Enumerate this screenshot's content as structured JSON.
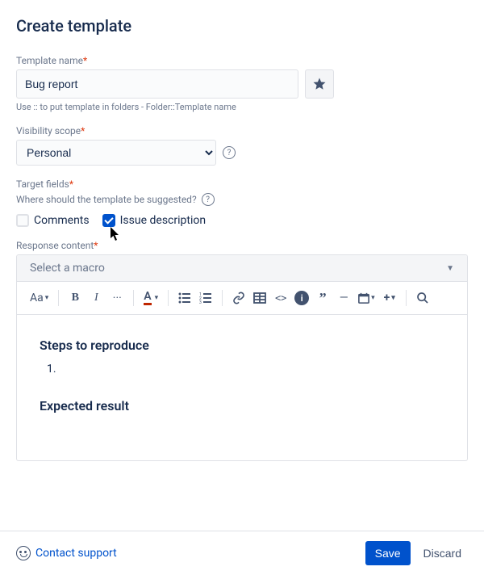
{
  "dialog": {
    "title": "Create template"
  },
  "templateName": {
    "label": "Template name",
    "required": "*",
    "value": "Bug report",
    "hint": "Use :: to put template in folders - Folder::Template name"
  },
  "visibility": {
    "label": "Visibility scope",
    "required": "*",
    "value": "Personal"
  },
  "targetFields": {
    "label": "Target fields",
    "required": "*",
    "hint": "Where should the template be suggested?",
    "options": [
      {
        "label": "Comments",
        "checked": false
      },
      {
        "label": "Issue description",
        "checked": true
      }
    ]
  },
  "responseContent": {
    "label": "Response content",
    "required": "*",
    "macroPlaceholder": "Select a macro"
  },
  "toolbar": {
    "textStyle": "Aa"
  },
  "editor": {
    "heading1": "Steps to reproduce",
    "listItem1": "",
    "heading2": "Expected result"
  },
  "footer": {
    "contact": "Contact support",
    "save": "Save",
    "discard": "Discard"
  }
}
